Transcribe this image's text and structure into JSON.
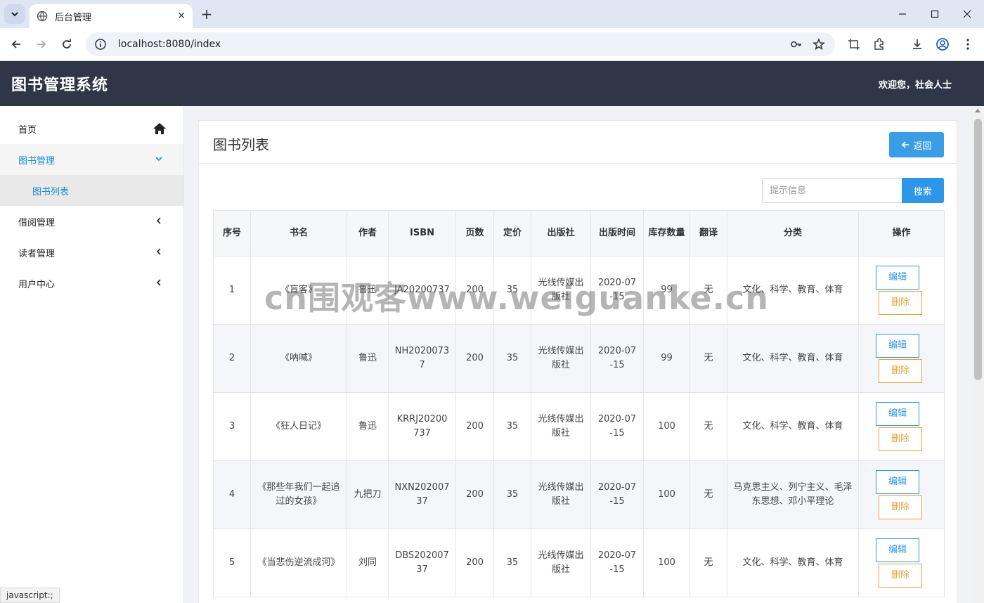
{
  "browser": {
    "tab_title": "后台管理",
    "url": "localhost:8080/index"
  },
  "app": {
    "title": "图书管理系统",
    "welcome": "欢迎您，社会人士"
  },
  "sidebar": {
    "items": [
      {
        "label": "首页",
        "icon": "home-icon"
      },
      {
        "label": "图书管理",
        "icon": "chevron-down-icon"
      },
      {
        "label": "图书列表"
      },
      {
        "label": "借阅管理",
        "icon": "chevron-left-icon"
      },
      {
        "label": "读者管理",
        "icon": "chevron-left-icon"
      },
      {
        "label": "用户中心",
        "icon": "chevron-left-icon"
      }
    ]
  },
  "panel": {
    "title": "图书列表",
    "back_label": "返回",
    "search_placeholder": "提示信息",
    "search_label": "搜索"
  },
  "table": {
    "headers": [
      "序号",
      "书名",
      "作者",
      "ISBN",
      "页数",
      "定价",
      "出版社",
      "出版时间",
      "库存数量",
      "翻译",
      "分类",
      "操作"
    ],
    "edit_label": "编辑",
    "delete_label": "删除",
    "rows": [
      [
        "1",
        "《盲客》",
        "鲁迅",
        "JA20200737",
        "200",
        "35",
        "光线传媒出版社",
        "2020-07-15",
        "99",
        "无",
        "文化、科学、教育、体育"
      ],
      [
        "2",
        "《呐喊》",
        "鲁迅",
        "NH20200737",
        "200",
        "35",
        "光线传媒出版社",
        "2020-07-15",
        "99",
        "无",
        "文化、科学、教育、体育"
      ],
      [
        "3",
        "《狂人日记》",
        "鲁迅",
        "KRRJ20200737",
        "200",
        "35",
        "光线传媒出版社",
        "2020-07-15",
        "100",
        "无",
        "文化、科学、教育、体育"
      ],
      [
        "4",
        "《那些年我们一起追过的女孩》",
        "九把刀",
        "NXN20200737",
        "200",
        "35",
        "光线传媒出版社",
        "2020-07-15",
        "100",
        "无",
        "马克思主义、列宁主义、毛泽东思想、邓小平理论"
      ],
      [
        "5",
        "《当悲伤逆流成河》",
        "刘同",
        "DBS20200737",
        "200",
        "35",
        "光线传媒出版社",
        "2020-07-15",
        "100",
        "无",
        "文化、科学、教育、体育"
      ]
    ]
  },
  "watermark": "cn围观客www.weiguanke.cn",
  "status_text": "javascript:;"
}
